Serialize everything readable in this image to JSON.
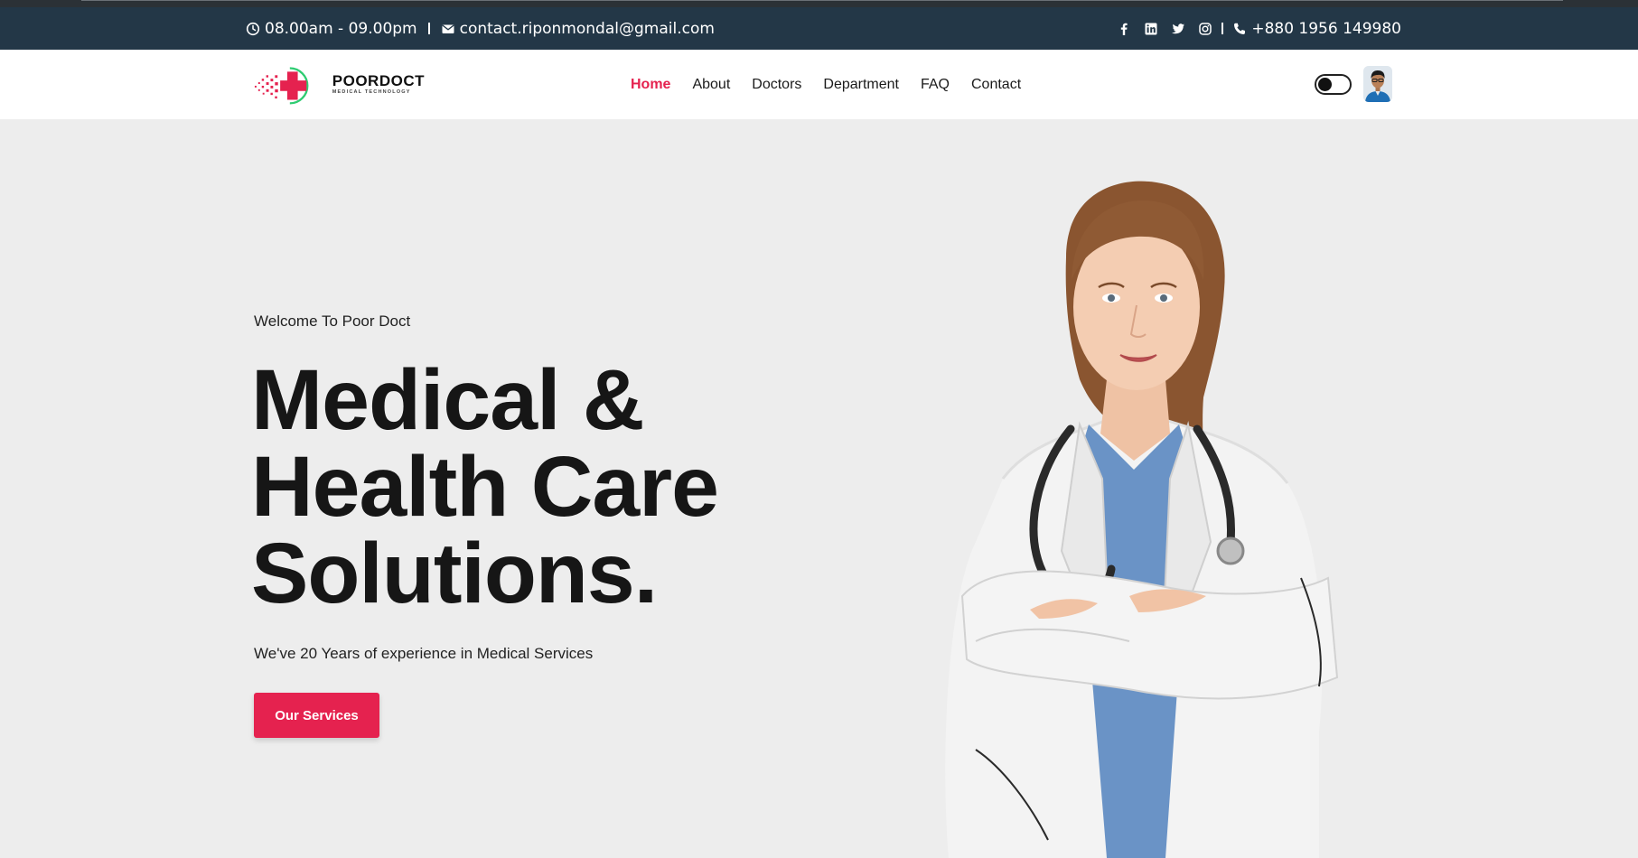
{
  "topbar": {
    "hours": "08.00am - 09.00pm",
    "email": "contact.riponmondal@gmail.com",
    "phone": "+880 1956 149980",
    "social_icons": [
      "facebook-icon",
      "linkedin-icon",
      "twitter-icon",
      "instagram-icon"
    ]
  },
  "brand": {
    "name": "POORDOCT",
    "tagline": "MEDICAL TECHNOLOGY"
  },
  "nav": {
    "items": [
      {
        "label": "Home",
        "active": true
      },
      {
        "label": "About",
        "active": false
      },
      {
        "label": "Doctors",
        "active": false
      },
      {
        "label": "Department",
        "active": false
      },
      {
        "label": "FAQ",
        "active": false
      },
      {
        "label": "Contact",
        "active": false
      }
    ]
  },
  "hero": {
    "welcome": "Welcome To Poor Doct",
    "title_line1": "Medical &",
    "title_line2": "Health Care",
    "title_line3": "Solutions.",
    "description": "We've 20 Years of experience in Medical Services",
    "cta_label": "Our Services"
  },
  "colors": {
    "accent": "#e5224f",
    "topbar_bg": "#233747",
    "hero_bg": "#ededed",
    "logo_green": "#2ecc71"
  }
}
